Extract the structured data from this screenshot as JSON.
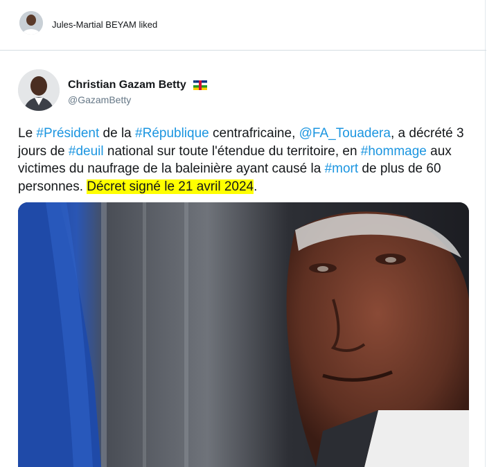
{
  "liked_bar": {
    "avatar": "user-avatar",
    "text": "Jules-Martial BEYAM liked"
  },
  "author": {
    "name": "Christian Gazam Betty",
    "flag": "central-african-republic-flag",
    "handle": "@GazamBetty"
  },
  "tweet": {
    "segments": [
      {
        "text": "Le ",
        "type": "text"
      },
      {
        "text": "#Président",
        "type": "hashtag"
      },
      {
        "text": " de la ",
        "type": "text"
      },
      {
        "text": "#République",
        "type": "hashtag"
      },
      {
        "text": " centrafricaine, ",
        "type": "text"
      },
      {
        "text": "@FA_Touadera",
        "type": "mention"
      },
      {
        "text": ", a décrété 3 jours de ",
        "type": "text"
      },
      {
        "text": "#deuil",
        "type": "hashtag"
      },
      {
        "text": " national sur toute l'étendue du territoire, en ",
        "type": "text"
      },
      {
        "text": "#hommage",
        "type": "hashtag"
      },
      {
        "text": " aux victimes du naufrage de la baleinière ayant causé la ",
        "type": "text"
      },
      {
        "text": "#mort",
        "type": "hashtag"
      },
      {
        "text": " de plus de 60 personnes. ",
        "type": "text"
      },
      {
        "text": "Décret signé le 21 avril 2024",
        "type": "highlight"
      },
      {
        "text": ".",
        "type": "text"
      }
    ]
  },
  "media": {
    "icon": "photo-portrait"
  },
  "colors": {
    "link": "#1b95e0",
    "highlight": "#ffff00",
    "text": "#14171a",
    "muted": "#657786",
    "border": "#e1e8ed"
  }
}
